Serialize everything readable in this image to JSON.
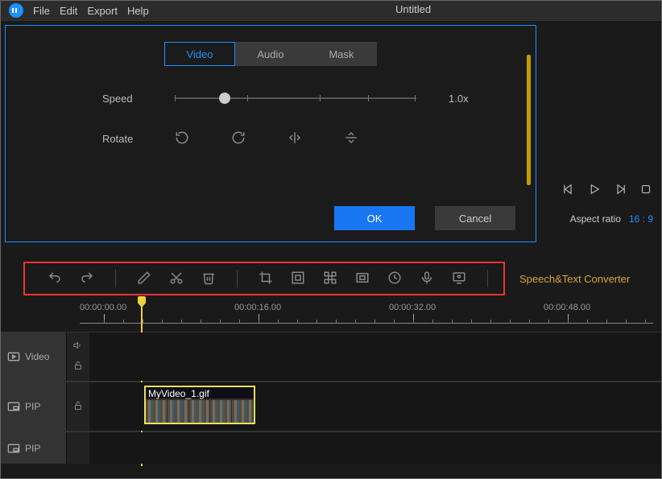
{
  "menubar": {
    "items": [
      "File",
      "Edit",
      "Export",
      "Help"
    ],
    "project_title": "Untitled"
  },
  "props_panel": {
    "tabs": {
      "video": "Video",
      "audio": "Audio",
      "mask": "Mask"
    },
    "speed_label": "Speed",
    "speed_value": "1.0x",
    "rotate_label": "Rotate",
    "ok_label": "OK",
    "cancel_label": "Cancel"
  },
  "preview": {
    "aspect_label": "Aspect ratio",
    "aspect_value": "16 : 9"
  },
  "toolbar": {
    "speech_text": "Speech&Text Converter"
  },
  "timeline": {
    "timecodes": [
      "00:00:00.00",
      "00:00:16.00",
      "00:00:32.00",
      "00:00:48.00"
    ]
  },
  "tracks": {
    "video_label": "Video",
    "pip_label": "PIP"
  },
  "clips": [
    {
      "name": "MyVideo_1.gif"
    }
  ]
}
